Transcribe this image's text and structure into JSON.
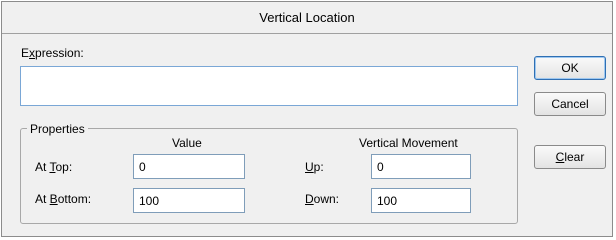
{
  "dialog": {
    "title": "Vertical Location",
    "expression": {
      "label_pre": "E",
      "label_accel": "x",
      "label_post": "pression:",
      "value": ""
    },
    "buttons": {
      "ok": "OK",
      "cancel": "Cancel",
      "clear_accel": "C",
      "clear_post": "lear"
    },
    "properties": {
      "legend": "Properties",
      "value_header": "Value",
      "movement_header": "Vertical Movement",
      "at_top_pre": "At ",
      "at_top_accel": "T",
      "at_top_post": "op:",
      "at_top_value": "0",
      "at_bottom_pre": "At ",
      "at_bottom_accel": "B",
      "at_bottom_post": "ottom:",
      "at_bottom_value": "100",
      "up_accel": "U",
      "up_post": "p:",
      "up_value": "0",
      "down_accel": "D",
      "down_post": "own:",
      "down_value": "100"
    }
  }
}
